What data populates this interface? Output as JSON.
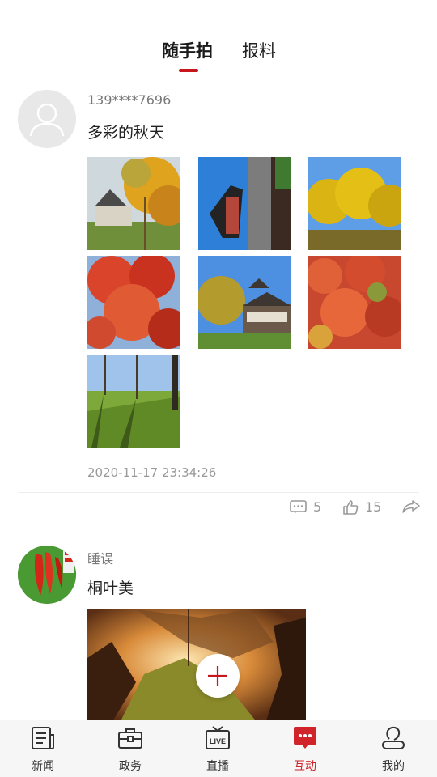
{
  "tabs": {
    "active": "随手拍",
    "inactive": "报料"
  },
  "posts": [
    {
      "user": "139****7696",
      "text": "多彩的秋天",
      "time": "2020-11-17 23:34:26",
      "comments": "5",
      "likes": "15"
    },
    {
      "user": "睡误",
      "text": "桐叶美"
    }
  ],
  "nav": {
    "items": [
      {
        "label": "新闻",
        "icon": "newspaper-icon"
      },
      {
        "label": "政务",
        "icon": "briefcase-icon"
      },
      {
        "label": "直播",
        "icon": "live-tv-icon"
      },
      {
        "label": "互动",
        "icon": "chat-bubble-icon"
      },
      {
        "label": "我的",
        "icon": "profile-icon"
      }
    ],
    "live_badge": "LIVE"
  },
  "colors": {
    "accent": "#c8161d",
    "nav_active": "#d0232a"
  }
}
